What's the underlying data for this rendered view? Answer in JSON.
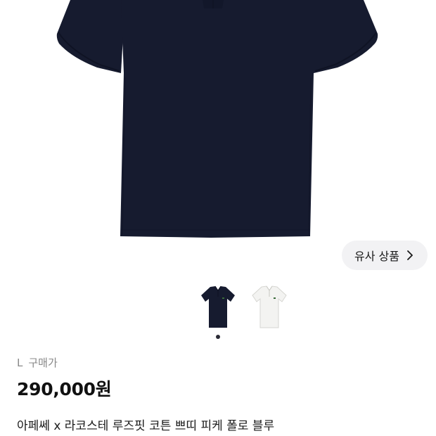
{
  "product_image": {
    "icon": "navy-polo-shirt-photo",
    "shirt_color": "#161b2f"
  },
  "similar_products": {
    "label": "유사 상품",
    "icon": "chevron-right-icon"
  },
  "color_options": [
    {
      "name": "navy",
      "color": "#161b2f",
      "selected": true
    },
    {
      "name": "white",
      "color": "#f3f3f1",
      "selected": false
    }
  ],
  "carousel": {
    "page": 1,
    "total": 1
  },
  "product": {
    "size": "L",
    "price_type": "구매가",
    "price": "290,000원",
    "title": "아페쎄 x 라코스테 루즈핏 코튼 쁘띠 피케 폴로 블루"
  },
  "colors": {
    "similar_button_bg": "#f2f2f4",
    "muted_text": "#888888"
  }
}
